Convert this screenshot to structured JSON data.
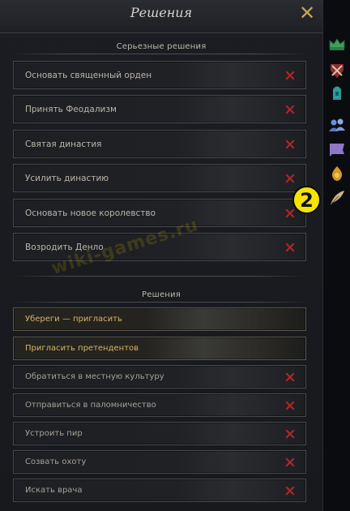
{
  "title": "Решения",
  "close_label": "✕",
  "serious": {
    "label": "Серьезные решения",
    "items": [
      {
        "label": "Основать священный орден"
      },
      {
        "label": "Принять Феодализм"
      },
      {
        "label": "Святая династия"
      },
      {
        "label": "Усилить династию"
      },
      {
        "label": "Основать новое королевство"
      },
      {
        "label": "Возродить Денло"
      }
    ]
  },
  "decisions": {
    "label": "Решения",
    "items": [
      {
        "label": "Убереги — пригласить",
        "available": true
      },
      {
        "label": "Пригласить претендентов",
        "available": true
      },
      {
        "label": "Обратиться в местную культуру",
        "available": false
      },
      {
        "label": "Отправиться в паломничество",
        "available": false
      },
      {
        "label": "Устроить пир",
        "available": false
      },
      {
        "label": "Созвать охоту",
        "available": false
      },
      {
        "label": "Искать врача",
        "available": false
      }
    ]
  },
  "watermark": "wiki-games.ru",
  "badge": "2",
  "side_icons": [
    "crown-icon",
    "crossed-swords-icon",
    "tower-icon",
    "people-icon",
    "flag-icon",
    "gold-icon",
    "feather-icon"
  ],
  "colors": {
    "accent": "#d8b46a",
    "unavailable": "#b3262a",
    "badge": "#f4e400"
  }
}
